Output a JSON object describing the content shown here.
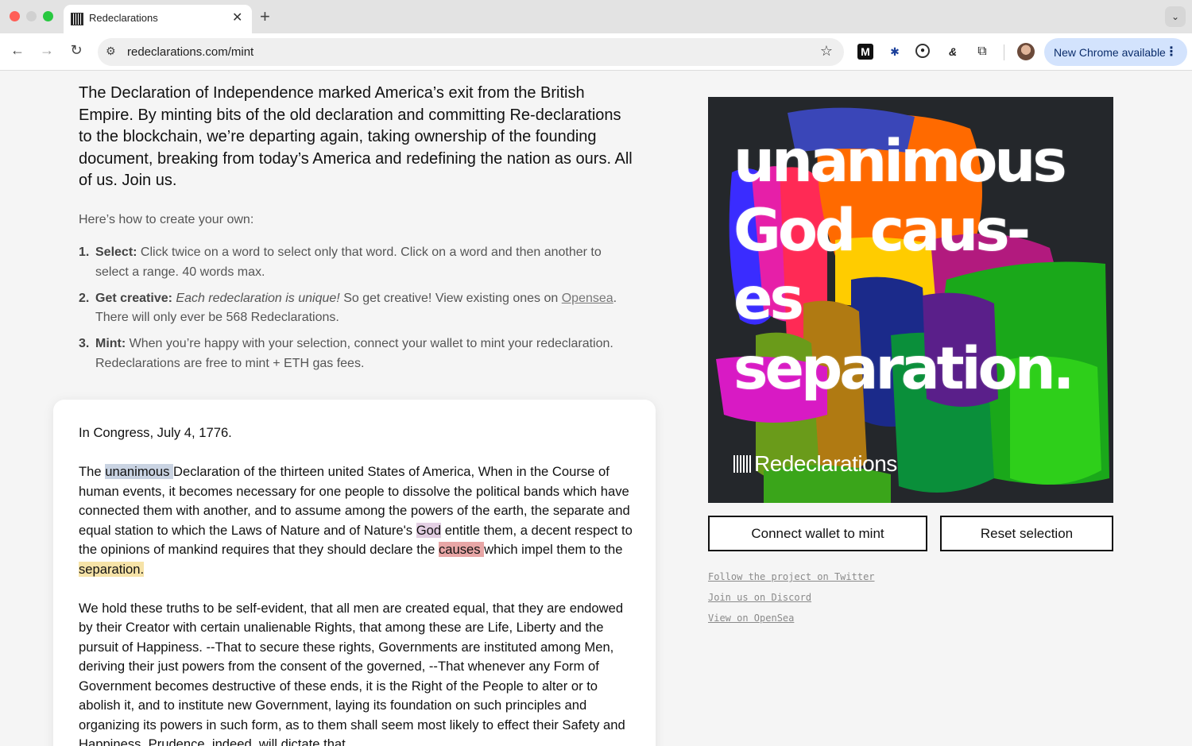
{
  "browser": {
    "tab_title": "Redeclarations",
    "url": "redeclarations.com/mint",
    "update_label": "New Chrome available"
  },
  "intro": "The Declaration of Independence marked America’s exit from the British Empire. By minting bits of the old declaration and committing Re-declarations to the blockchain, we’re departing again, taking ownership of the founding document, breaking from today’s America and redefining the nation as ours. All of us. Join us.",
  "howto": "Here’s how to create your own:",
  "steps": [
    {
      "num": "1.",
      "label": "Select:",
      "text": " Click twice on a word to select only that word. Click on a word and then another to select a range. 40 words max."
    },
    {
      "num": "2.",
      "label": "Get creative:",
      "emph": "Each redeclaration is unique!",
      "text_a": " So get creative! View existing ones on ",
      "link": "Opensea",
      "text_b": ". There will only ever be 568 Redeclarations."
    },
    {
      "num": "3.",
      "label": "Mint:",
      "text": " When you’re happy with your selection, connect your wallet to mint your redeclaration. Redeclarations are free to mint + ETH gas fees."
    }
  ],
  "document": {
    "heading": "In Congress, July 4, 1776.",
    "p1": {
      "a": "The ",
      "w1": "unanimous ",
      "b": "Declaration of the thirteen united States of America, When in the Course of human events, it becomes necessary for one people to dissolve the political bands which have connected them with another, and to assume among the powers of the earth, the separate and equal station to which the Laws of Nature and of Nature's ",
      "w2": "God",
      "c": " entitle them, a decent respect to the opinions of mankind requires that they should declare the ",
      "w3": "causes ",
      "d": "which impel them to the ",
      "w4": "separation."
    },
    "p2": "We hold these truths to be self-evident, that all men are created equal, that they are endowed by their Creator with certain unalienable Rights, that among these are Life, Liberty and the pursuit of Happiness. --That to secure these rights, Governments are instituted among Men, deriving their just powers from the consent of the governed, --That whenever any Form of Government becomes destructive of these ends, it is the Right of the People to alter or to abolish it, and to institute new Government, laying its foundation on such principles and organizing its powers in such form, as to them shall seem most likely to effect their Safety and Happiness. Prudence, indeed, will dictate that"
  },
  "artwork": {
    "line1": "unanimous",
    "line2": "God caus-",
    "line3": "es",
    "line4": "separation.",
    "brand": "Redeclarations"
  },
  "buttons": {
    "connect": "Connect wallet to mint",
    "reset": "Reset selection"
  },
  "links": [
    "Follow the project on Twitter",
    "Join us on Discord",
    "View on OpenSea"
  ],
  "colors": {
    "highlight_unanimous": "#c9d3e2",
    "highlight_god": "#e3cfe3",
    "highlight_causes": "#e8a6a6",
    "highlight_separation": "#f6e3a8"
  }
}
